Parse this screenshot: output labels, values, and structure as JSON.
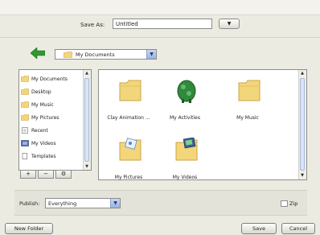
{
  "save_as": {
    "label": "Save As:",
    "value": "Untitled"
  },
  "location": {
    "label": "My Documents"
  },
  "sidebar": {
    "items": [
      {
        "label": "My Documents",
        "icon": "folder-icon"
      },
      {
        "label": "Desktop",
        "icon": "folder-icon"
      },
      {
        "label": "My Music",
        "icon": "folder-icon"
      },
      {
        "label": "My Pictures",
        "icon": "folder-icon"
      },
      {
        "label": "Recent",
        "icon": "recent-icon"
      },
      {
        "label": "My Videos",
        "icon": "video-icon"
      },
      {
        "label": "Templates",
        "icon": "document-icon"
      }
    ],
    "buttons": [
      "+",
      "−",
      "⚙"
    ]
  },
  "files": [
    {
      "label": "Clay Animation ...",
      "icon": "folder-icon"
    },
    {
      "label": "My Activities",
      "icon": "activity-icon"
    },
    {
      "label": "My Music",
      "icon": "folder-icon"
    },
    {
      "label": "My Pictures",
      "icon": "pictures-folder-icon"
    },
    {
      "label": "My Videos",
      "icon": "videos-folder-icon"
    }
  ],
  "publish": {
    "label": "Publish:",
    "value": "Everything"
  },
  "zip": {
    "label": "Zip",
    "checked": false
  },
  "buttons": {
    "new_folder": "New Folder",
    "save": "Save",
    "cancel": "Cancel"
  },
  "colors": {
    "back_arrow": "#2e9a2e",
    "folder": "#f3d67a",
    "folder_edge": "#c9a548"
  }
}
